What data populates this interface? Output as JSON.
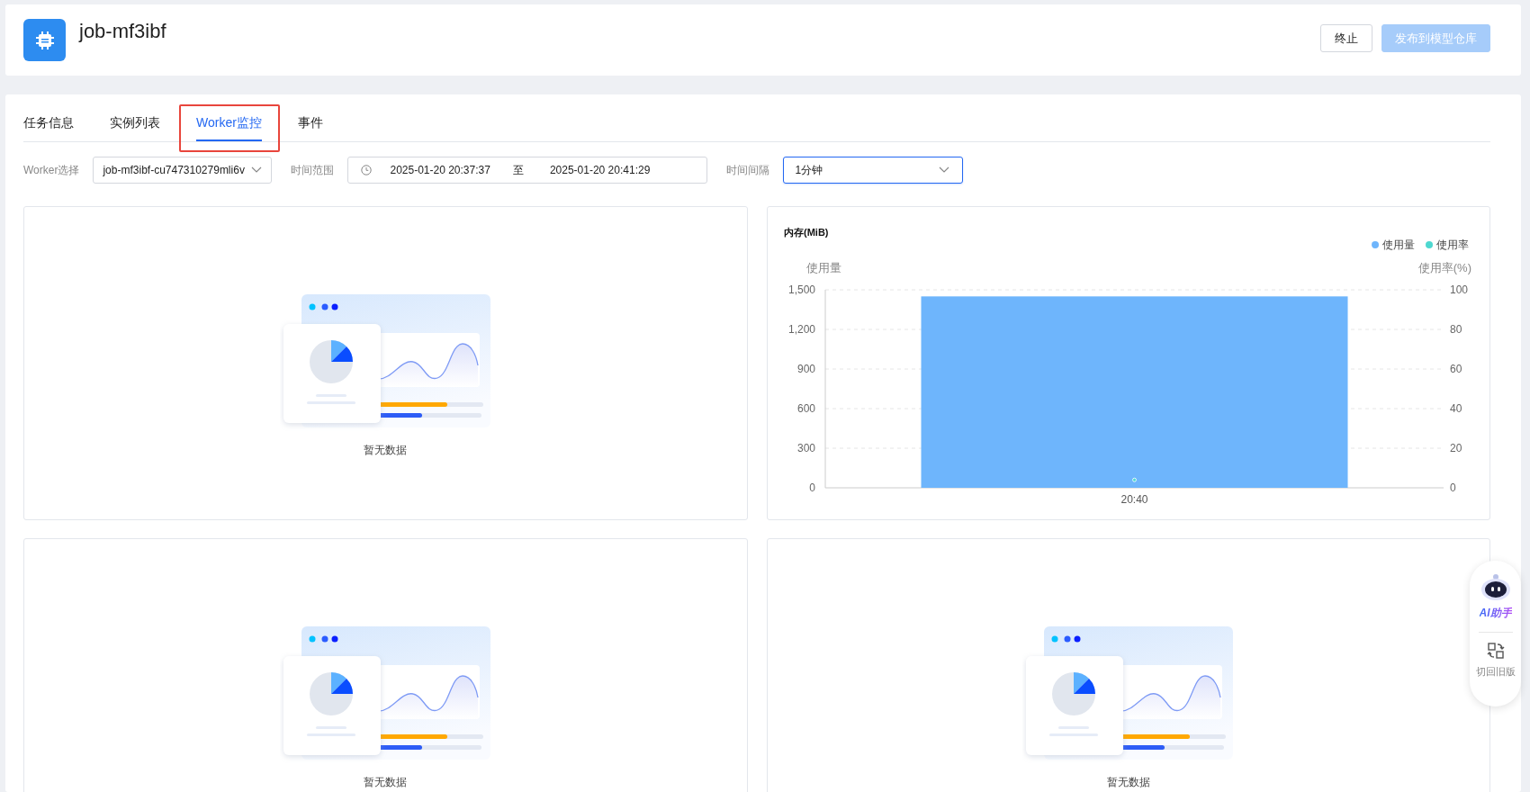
{
  "header": {
    "title": "job-mf3ibf",
    "buttons": [
      {
        "label": "终止",
        "kind": "default",
        "disabled": false
      },
      {
        "label": "发布到模型仓库",
        "kind": "primary",
        "disabled": true
      }
    ]
  },
  "tabs": [
    {
      "label": "任务信息",
      "selected": false,
      "highlighted": false
    },
    {
      "label": "实例列表",
      "selected": false,
      "highlighted": false
    },
    {
      "label": "Worker监控",
      "selected": true,
      "highlighted": true
    },
    {
      "label": "事件",
      "selected": false,
      "highlighted": false
    }
  ],
  "filters": {
    "worker": {
      "label": "Worker选择",
      "value": "job-mf3ibf-cu747310279mli6v"
    },
    "time_range": {
      "label": "时间范围",
      "start": "2025-01-20 20:37:37",
      "separator": "至",
      "end": "2025-01-20 20:41:29"
    },
    "interval": {
      "label": "时间间隔",
      "value": "1分钟",
      "focused": true
    }
  },
  "panel_rows": [
    {
      "panels": [
        {
          "kind": "empty",
          "text": "暂无数据"
        },
        {
          "kind": "chart",
          "chart_data": {
            "type": "bar",
            "title": "内存(MiB)",
            "ylabel": "使用量",
            "y2label": "使用率(%)",
            "categories": [
              "20:40"
            ],
            "series": [
              {
                "name": "使用量",
                "color": "#6eb5fc",
                "values": [
                  1450
                ]
              },
              {
                "name": "使用率",
                "color": "#4ed8d0",
                "values": [
                  4
                ]
              }
            ],
            "grid": true,
            "ylim": [
              0,
              1500
            ],
            "yticks": [
              0,
              300,
              600,
              900,
              {
                "value": 1200,
                "label": "1,200"
              },
              {
                "value": 1500,
                "label": "1,500"
              }
            ],
            "annotations": [
              "0",
              "20",
              "40",
              "60",
              "80",
              "100"
            ]
          }
        }
      ]
    },
    {
      "panels": [
        {
          "kind": "empty",
          "text": "暂无数据"
        },
        {
          "kind": "empty",
          "text": "暂无数据"
        }
      ]
    }
  ],
  "assistant": {
    "ai_label": "AI助手",
    "switch_label": "切回旧版"
  }
}
